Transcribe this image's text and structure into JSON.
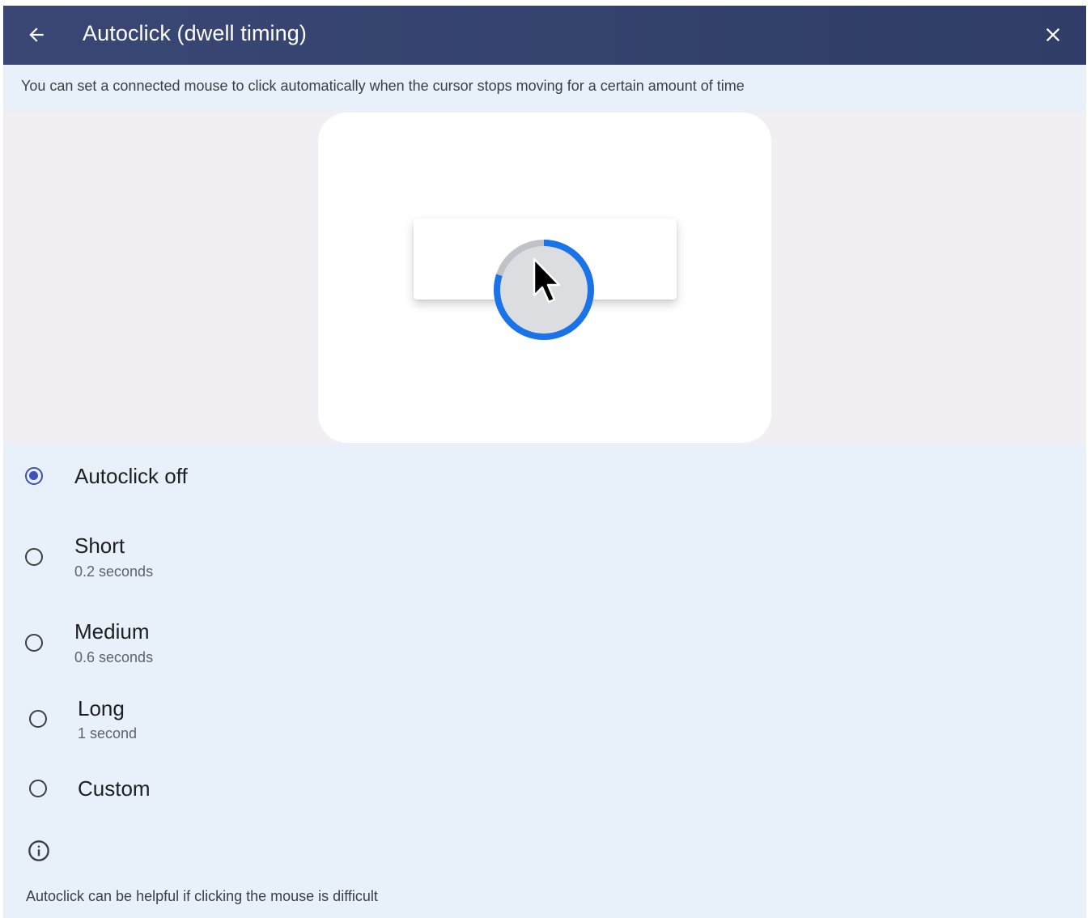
{
  "appbar": {
    "title": "Autoclick (dwell timing)",
    "back_icon": "arrow-back-icon",
    "close_icon": "close-icon"
  },
  "description": "You can set a connected mouse to click automatically when the cursor stops moving for a certain amount of time",
  "illustration": {
    "icon": "dwell-cursor-progress-icon",
    "ring_progress": 0.8,
    "ring_color": "#1a73e8"
  },
  "options": [
    {
      "label": "Autoclick off",
      "sub": "",
      "selected": true
    },
    {
      "label": "Short",
      "sub": "0.2 seconds",
      "selected": false
    },
    {
      "label": "Medium",
      "sub": "0.6 seconds",
      "selected": false
    },
    {
      "label": "Long",
      "sub": "1 second",
      "selected": false
    },
    {
      "label": "Custom",
      "sub": "",
      "selected": false
    }
  ],
  "info": {
    "icon": "info-icon",
    "text": "Autoclick can be helpful if clicking the mouse is difficult"
  },
  "colors": {
    "appbar": "#33406b",
    "accent": "#3f51b5",
    "background": "#e8f0f9"
  }
}
